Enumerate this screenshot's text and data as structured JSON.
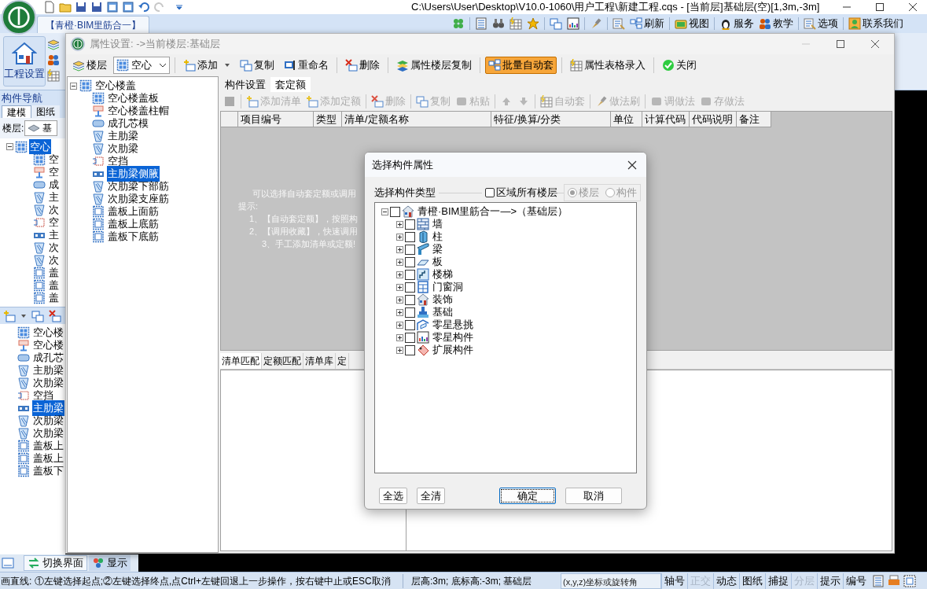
{
  "title_bar": {
    "title": "C:\\Users\\User\\Desktop\\V10.0-1060\\用户工程\\新建工程.cqs - [当前层]基础层(空)[1,3m,-3m]"
  },
  "ribbon": {
    "tab": "【青橙·BIM里筋合一】",
    "big_button": "工程设置",
    "tools": [
      "刷新",
      "视图",
      "服务",
      "教学",
      "选项",
      "联系我们"
    ]
  },
  "navigator": {
    "title": "构件导航",
    "tabs": [
      {
        "label": "建模",
        "selected": true
      },
      {
        "label": "图纸",
        "selected": false
      }
    ],
    "floor_label": "楼层:",
    "floor_value": "基",
    "tree": {
      "label": "空心",
      "selected": true,
      "children": [
        {
          "label": "空",
          "selected": false
        },
        {
          "label": "空",
          "selected": false
        },
        {
          "label": "成",
          "selected": false
        },
        {
          "label": "主",
          "selected": false
        },
        {
          "label": "次",
          "selected": false
        },
        {
          "label": "空",
          "selected": false
        },
        {
          "label": "主",
          "selected": false
        },
        {
          "label": "次",
          "selected": false
        },
        {
          "label": "次",
          "selected": false
        },
        {
          "label": "盖",
          "selected": false
        },
        {
          "label": "盖",
          "selected": false
        },
        {
          "label": "盖",
          "selected": false
        }
      ]
    },
    "list": [
      {
        "label": "空心楼",
        "selected": false
      },
      {
        "label": "空心楼",
        "selected": false
      },
      {
        "label": "成孔芯",
        "selected": false
      },
      {
        "label": "主肋梁",
        "selected": false
      },
      {
        "label": "次肋梁",
        "selected": false
      },
      {
        "label": "空挡",
        "selected": false
      },
      {
        "label": "主肋梁",
        "selected": true
      },
      {
        "label": "次肋梁",
        "selected": false
      },
      {
        "label": "次肋梁",
        "selected": false
      },
      {
        "label": "盖板上",
        "selected": false
      },
      {
        "label": "盖板上",
        "selected": false
      },
      {
        "label": "盖板下",
        "selected": false
      }
    ]
  },
  "property_window": {
    "title": "属性设置: ->当前楼层:基础层",
    "toolbar": [
      {
        "kind": "button",
        "label": "楼层",
        "pressed": false
      },
      {
        "kind": "combo",
        "label": "空心"
      },
      {
        "kind": "dropdown",
        "label": "添加",
        "pressed": false
      },
      {
        "kind": "button",
        "label": "复制",
        "pressed": false
      },
      {
        "kind": "button",
        "label": "重命名",
        "pressed": false
      },
      {
        "kind": "button",
        "label": "删除",
        "pressed": false
      },
      {
        "kind": "button",
        "label": "属性楼层复制",
        "pressed": false
      },
      {
        "kind": "button",
        "label": "批量自动套",
        "pressed": true
      },
      {
        "kind": "button",
        "label": "属性表格录入",
        "pressed": false
      },
      {
        "kind": "button",
        "label": "关闭",
        "pressed": false
      }
    ],
    "tree": {
      "label": "空心楼盖",
      "selected": false,
      "children": [
        {
          "label": "空心楼盖板",
          "selected": false
        },
        {
          "label": "空心楼盖柱帽",
          "selected": false
        },
        {
          "label": "成孔芯模",
          "selected": false
        },
        {
          "label": "主肋梁",
          "selected": false
        },
        {
          "label": "次肋梁",
          "selected": false
        },
        {
          "label": "空挡",
          "selected": false
        },
        {
          "label": "主肋梁侧腋",
          "selected": true
        },
        {
          "label": "次肋梁下部筋",
          "selected": false
        },
        {
          "label": "次肋梁支座筋",
          "selected": false
        },
        {
          "label": "盖板上面筋",
          "selected": false
        },
        {
          "label": "盖板上底筋",
          "selected": false
        },
        {
          "label": "盖板下底筋",
          "selected": false
        }
      ]
    },
    "tabs": [
      {
        "label": "构件设置",
        "selected": false
      },
      {
        "label": "套定额",
        "selected": true
      }
    ],
    "method_toolbar": [
      {
        "disabled": true
      },
      {
        "label": "添加清单",
        "disabled": true
      },
      {
        "label": "添加定额",
        "disabled": true
      },
      {
        "label": "删除",
        "disabled": true
      },
      {
        "label": "复制",
        "disabled": true
      },
      {
        "label": "粘贴",
        "disabled": true
      },
      {
        "disabled": true
      },
      {
        "disabled": true
      },
      {
        "label": "自动套",
        "disabled": true
      },
      {
        "label": "做法刷",
        "disabled": true
      },
      {
        "label": "调做法",
        "disabled": true
      },
      {
        "label": "存做法",
        "disabled": true
      }
    ],
    "columns": [
      "项目编号",
      "类型",
      "清单/定额名称",
      "特征/换算/分类",
      "单位",
      "计算代码",
      "代码说明",
      "备注"
    ],
    "hint_lines": [
      "可以选择自动套定额或调用",
      "提示:",
      "1、【自动套定额】，按照构",
      "2、【调用收藏】，快速调用",
      "3、手工添加清单或定额!"
    ],
    "bottom_tabs": [
      {
        "label": "清单匹配",
        "selected": true
      },
      {
        "label": "定额匹配",
        "selected": false
      },
      {
        "label": "清单库",
        "selected": false
      },
      {
        "label": "定",
        "selected": false
      }
    ]
  },
  "dialog": {
    "title": "选择构件属性",
    "group_label": "选择构件类型",
    "all_floors": {
      "label": "区域所有楼层",
      "checked": false
    },
    "scope": [
      {
        "label": "楼层",
        "selected": true,
        "disabled": true
      },
      {
        "label": "构件",
        "selected": false,
        "disabled": true
      }
    ],
    "tree": {
      "label": "青橙·BIM里筋合一—>（基础层）",
      "checked": false,
      "expanded": true,
      "children": [
        {
          "label": "墙",
          "checked": false,
          "expanded": false
        },
        {
          "label": "柱",
          "checked": false,
          "expanded": false
        },
        {
          "label": "梁",
          "checked": false,
          "expanded": false
        },
        {
          "label": "板",
          "checked": false,
          "expanded": false
        },
        {
          "label": "楼梯",
          "checked": false,
          "expanded": false
        },
        {
          "label": "门窗洞",
          "checked": false,
          "expanded": false
        },
        {
          "label": "装饰",
          "checked": false,
          "expanded": false
        },
        {
          "label": "基础",
          "checked": false,
          "expanded": false
        },
        {
          "label": "零星悬挑",
          "checked": false,
          "expanded": false
        },
        {
          "label": "零星构件",
          "checked": false,
          "expanded": false
        },
        {
          "label": "扩展构件",
          "checked": false,
          "expanded": false
        }
      ]
    },
    "buttons": [
      {
        "label": "全选",
        "focused": false
      },
      {
        "label": "全清",
        "focused": false
      },
      {
        "label": "确定",
        "focused": true
      },
      {
        "label": "取消",
        "focused": false
      }
    ]
  },
  "bottom_tabs": [
    {
      "label": "切换界面",
      "selected": true
    },
    {
      "label": "显示",
      "selected": false
    }
  ],
  "status_bar": {
    "message": "画直线: ①左键选择起点;②左键选择终点,点Ctrl+左键回退上一步操作，按右键中止或ESC取消",
    "floor_info": "层高:3m; 底标高:-3m; 基础层",
    "coord_field": "(x,y,z)坐标或旋转角",
    "toggles": [
      {
        "label": "轴号",
        "disabled": false
      },
      {
        "label": "正交",
        "disabled": true
      },
      {
        "label": "动态",
        "disabled": false
      },
      {
        "label": "图纸",
        "disabled": false
      },
      {
        "label": "捕捉",
        "disabled": false
      },
      {
        "label": "分层",
        "disabled": true
      },
      {
        "label": "提示",
        "disabled": false
      },
      {
        "label": "编号",
        "disabled": false
      }
    ]
  }
}
